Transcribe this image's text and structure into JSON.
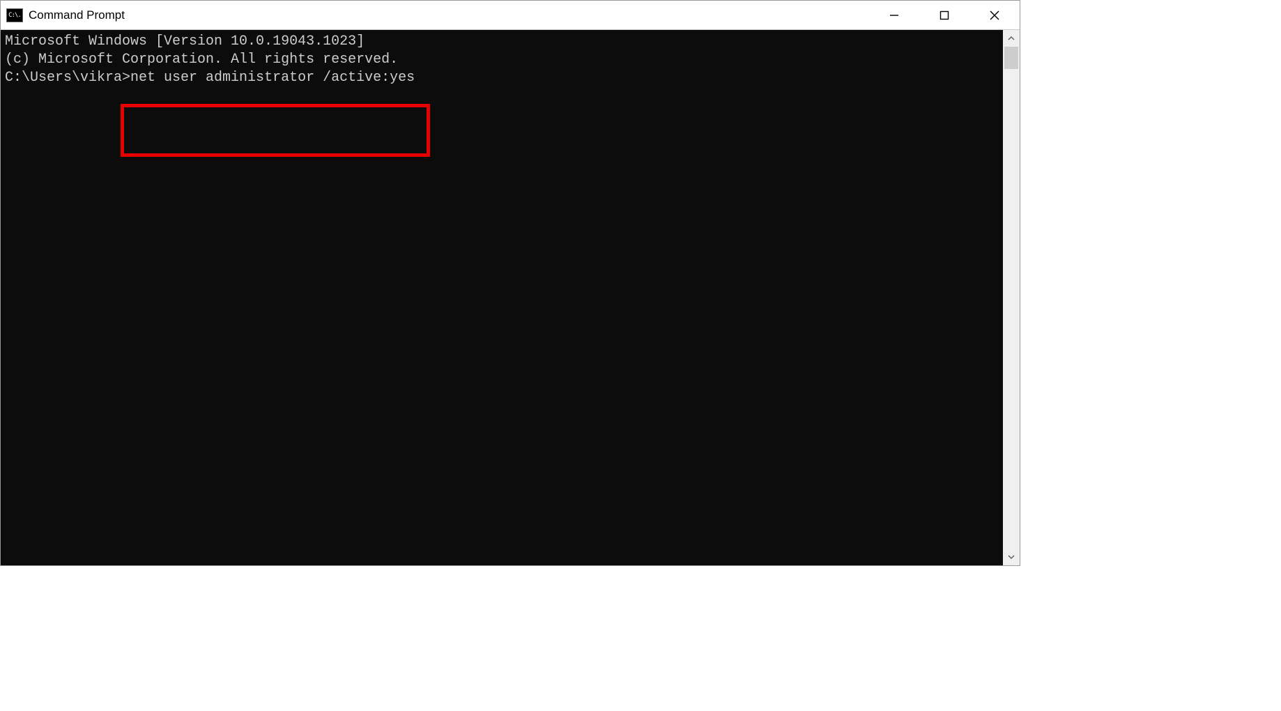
{
  "window": {
    "title": "Command Prompt",
    "icon_label": "C:\\."
  },
  "terminal": {
    "line1": "Microsoft Windows [Version 10.0.19043.1023]",
    "line2": "(c) Microsoft Corporation. All rights reserved.",
    "blank": "",
    "prompt": "C:\\Users\\vikra>",
    "command": "net user administrator /active:yes"
  },
  "annotation": {
    "highlight_color": "#e60000"
  }
}
